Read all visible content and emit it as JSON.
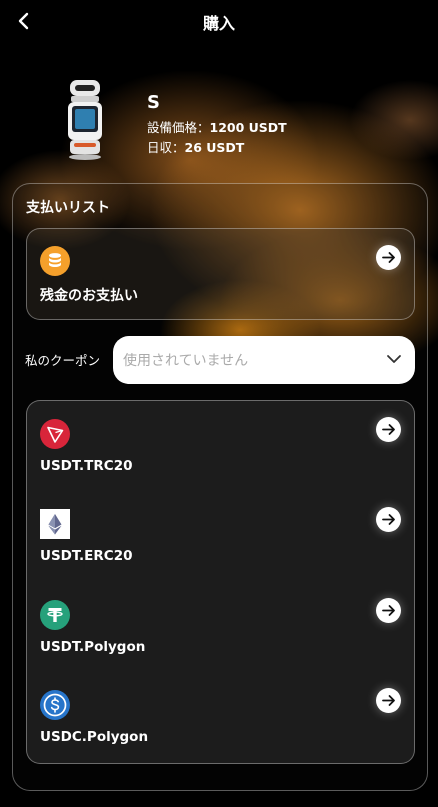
{
  "header": {
    "title": "購入"
  },
  "product": {
    "name": "S",
    "price_label": "設備価格：",
    "price_value": "1200 USDT",
    "daily_label": "日収：",
    "daily_value": "26 USDT"
  },
  "payment": {
    "section_title": "支払いリスト",
    "balance_label": "残金のお支払い"
  },
  "coupon": {
    "label": "私のクーポン",
    "value": "使用されていません"
  },
  "methods": [
    {
      "label": "USDT.TRC20",
      "icon": "tron-icon"
    },
    {
      "label": "USDT.ERC20",
      "icon": "ethereum-icon"
    },
    {
      "label": "USDT.Polygon",
      "icon": "tether-icon"
    },
    {
      "label": "USDC.Polygon",
      "icon": "usdc-icon"
    }
  ],
  "colors": {
    "background": "#000000",
    "accent_orange": "#f5a02b",
    "tron_red": "#d8253a",
    "tether_green": "#26a17b",
    "usdc_blue": "#2775ca"
  }
}
